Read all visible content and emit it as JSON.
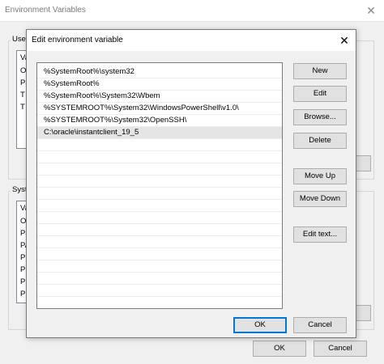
{
  "background_window": {
    "title": "Environment Variables",
    "close_glyph": "✕",
    "user_group_label": "Use",
    "user_list_rows": [
      "Va",
      "O",
      "Pa",
      "T",
      "T"
    ],
    "system_group_label": "Syste",
    "system_list_rows": [
      "Va",
      "O",
      "Pa",
      "PA",
      "PF",
      "PF",
      "PF",
      "PF"
    ],
    "ok_label": "OK",
    "cancel_label": "Cancel"
  },
  "dialog": {
    "title": "Edit environment variable",
    "close_glyph": "✕",
    "path_entries": [
      "%SystemRoot%\\system32",
      "%SystemRoot%",
      "%SystemRoot%\\System32\\Wbem",
      "%SYSTEMROOT%\\System32\\WindowsPowerShell\\v1.0\\",
      "%SYSTEMROOT%\\System32\\OpenSSH\\",
      "C:\\oracle\\instantclient_19_5"
    ],
    "selected_index": 5,
    "buttons": {
      "new": "New",
      "edit": "Edit",
      "browse": "Browse...",
      "delete": "Delete",
      "move_up": "Move Up",
      "move_down": "Move Down",
      "edit_text": "Edit text..."
    },
    "ok_label": "OK",
    "cancel_label": "Cancel",
    "accent_color": "#0078d7"
  }
}
